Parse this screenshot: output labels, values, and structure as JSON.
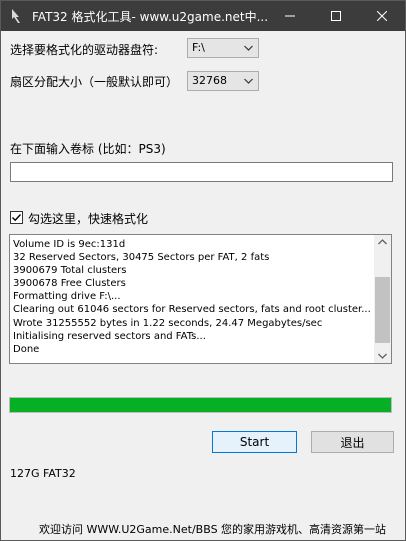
{
  "window": {
    "title": "FAT32 格式化工具- www.u2game.net中..."
  },
  "drive": {
    "label": "选择要格式化的驱动器盘符:",
    "selected": "F:\\"
  },
  "cluster": {
    "label": "扇区分配大小（一般默认即可）",
    "selected": "32768"
  },
  "volume": {
    "label": "在下面输入卷标 (比如：PS3)",
    "value": ""
  },
  "quick_format": {
    "label": "勾选这里，快速格式化",
    "checked": true
  },
  "log": {
    "lines": [
      "Volume ID is 9ec:131d",
      "32 Reserved Sectors, 30475 Sectors per FAT, 2 fats",
      "3900679 Total clusters",
      "3900678 Free Clusters",
      "Formatting drive F:\\...",
      "Clearing out 61046 sectors for Reserved sectors, fats and root cluster...",
      "Wrote 31255552 bytes in 1.22 seconds, 24.47 Megabytes/sec",
      "Initialising reserved sectors and FATs...",
      "Done"
    ]
  },
  "progress": {
    "percent": 100,
    "color": "#06b025"
  },
  "buttons": {
    "start": "Start",
    "exit": "退出"
  },
  "status": {
    "text": "127G FAT32"
  },
  "footer": {
    "text": "欢迎访问 WWW.U2Game.Net/BBS 您的家用游戏机、高清资源第一站"
  }
}
